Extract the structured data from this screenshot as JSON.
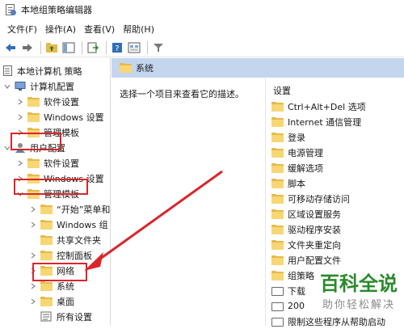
{
  "window": {
    "title": "本地组策略编辑器"
  },
  "menu": [
    "文件(F)",
    "操作(A)",
    "查看(V)",
    "帮助(H)"
  ],
  "toolbar": {
    "buttons": [
      "back-arrow",
      "forward-arrow",
      "up-folder",
      "show-hide-tree",
      "export-list",
      "help",
      "properties-sheet",
      "filter"
    ]
  },
  "tree": {
    "root": "本地计算机 策略",
    "computer_config": "计算机配置",
    "cc_children": [
      "软件设置",
      "Windows 设置",
      "管理模板"
    ],
    "user_config": "用户配置",
    "uc_children": [
      "软件设置",
      "Windows 设置",
      "管理模板"
    ],
    "admin_templates_children": [
      "“开始”菜单和",
      "Windows 组",
      "共享文件夹",
      "控制面板",
      "网络",
      "系统",
      "桌面",
      "所有设置"
    ]
  },
  "right": {
    "header": "系统",
    "description": "选择一个项目来查看它的描述。",
    "column_header": "设置",
    "items": [
      "Ctrl+Alt+Del 选项",
      "Internet 通信管理",
      "登录",
      "电源管理",
      "缓解选项",
      "脚本",
      "可移动存储访问",
      "区域设置服务",
      "驱动程序安装",
      "文件夹重定向",
      "用户配置文件",
      "组策略",
      "下载",
      "200",
      "限制这些程序从帮助启动"
    ]
  },
  "watermark": {
    "main": "百科全说",
    "sub": "助你轻松解决"
  },
  "colors": {
    "highlight": "#d9262b",
    "header_band": "#c4d5ee",
    "folder": "#f7d774"
  }
}
